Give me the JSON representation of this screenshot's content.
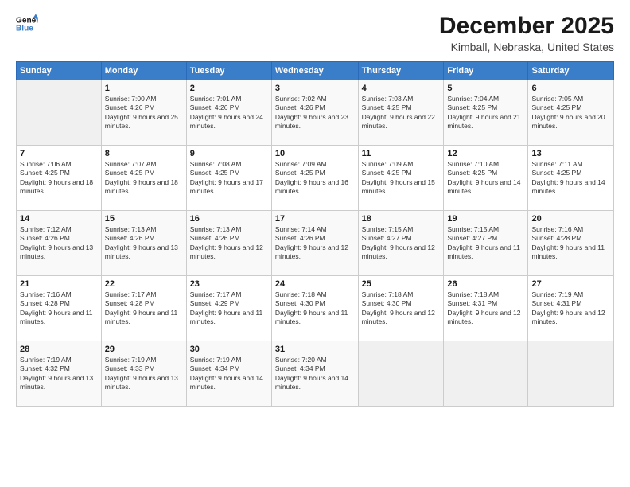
{
  "header": {
    "title": "December 2025",
    "subtitle": "Kimball, Nebraska, United States"
  },
  "columns": [
    "Sunday",
    "Monday",
    "Tuesday",
    "Wednesday",
    "Thursday",
    "Friday",
    "Saturday"
  ],
  "weeks": [
    [
      {
        "day": "",
        "sunrise": "",
        "sunset": "",
        "daylight": ""
      },
      {
        "day": "1",
        "sunrise": "Sunrise: 7:00 AM",
        "sunset": "Sunset: 4:26 PM",
        "daylight": "Daylight: 9 hours and 25 minutes."
      },
      {
        "day": "2",
        "sunrise": "Sunrise: 7:01 AM",
        "sunset": "Sunset: 4:26 PM",
        "daylight": "Daylight: 9 hours and 24 minutes."
      },
      {
        "day": "3",
        "sunrise": "Sunrise: 7:02 AM",
        "sunset": "Sunset: 4:26 PM",
        "daylight": "Daylight: 9 hours and 23 minutes."
      },
      {
        "day": "4",
        "sunrise": "Sunrise: 7:03 AM",
        "sunset": "Sunset: 4:25 PM",
        "daylight": "Daylight: 9 hours and 22 minutes."
      },
      {
        "day": "5",
        "sunrise": "Sunrise: 7:04 AM",
        "sunset": "Sunset: 4:25 PM",
        "daylight": "Daylight: 9 hours and 21 minutes."
      },
      {
        "day": "6",
        "sunrise": "Sunrise: 7:05 AM",
        "sunset": "Sunset: 4:25 PM",
        "daylight": "Daylight: 9 hours and 20 minutes."
      }
    ],
    [
      {
        "day": "7",
        "sunrise": "Sunrise: 7:06 AM",
        "sunset": "Sunset: 4:25 PM",
        "daylight": "Daylight: 9 hours and 18 minutes."
      },
      {
        "day": "8",
        "sunrise": "Sunrise: 7:07 AM",
        "sunset": "Sunset: 4:25 PM",
        "daylight": "Daylight: 9 hours and 18 minutes."
      },
      {
        "day": "9",
        "sunrise": "Sunrise: 7:08 AM",
        "sunset": "Sunset: 4:25 PM",
        "daylight": "Daylight: 9 hours and 17 minutes."
      },
      {
        "day": "10",
        "sunrise": "Sunrise: 7:09 AM",
        "sunset": "Sunset: 4:25 PM",
        "daylight": "Daylight: 9 hours and 16 minutes."
      },
      {
        "day": "11",
        "sunrise": "Sunrise: 7:09 AM",
        "sunset": "Sunset: 4:25 PM",
        "daylight": "Daylight: 9 hours and 15 minutes."
      },
      {
        "day": "12",
        "sunrise": "Sunrise: 7:10 AM",
        "sunset": "Sunset: 4:25 PM",
        "daylight": "Daylight: 9 hours and 14 minutes."
      },
      {
        "day": "13",
        "sunrise": "Sunrise: 7:11 AM",
        "sunset": "Sunset: 4:25 PM",
        "daylight": "Daylight: 9 hours and 14 minutes."
      }
    ],
    [
      {
        "day": "14",
        "sunrise": "Sunrise: 7:12 AM",
        "sunset": "Sunset: 4:26 PM",
        "daylight": "Daylight: 9 hours and 13 minutes."
      },
      {
        "day": "15",
        "sunrise": "Sunrise: 7:13 AM",
        "sunset": "Sunset: 4:26 PM",
        "daylight": "Daylight: 9 hours and 13 minutes."
      },
      {
        "day": "16",
        "sunrise": "Sunrise: 7:13 AM",
        "sunset": "Sunset: 4:26 PM",
        "daylight": "Daylight: 9 hours and 12 minutes."
      },
      {
        "day": "17",
        "sunrise": "Sunrise: 7:14 AM",
        "sunset": "Sunset: 4:26 PM",
        "daylight": "Daylight: 9 hours and 12 minutes."
      },
      {
        "day": "18",
        "sunrise": "Sunrise: 7:15 AM",
        "sunset": "Sunset: 4:27 PM",
        "daylight": "Daylight: 9 hours and 12 minutes."
      },
      {
        "day": "19",
        "sunrise": "Sunrise: 7:15 AM",
        "sunset": "Sunset: 4:27 PM",
        "daylight": "Daylight: 9 hours and 11 minutes."
      },
      {
        "day": "20",
        "sunrise": "Sunrise: 7:16 AM",
        "sunset": "Sunset: 4:28 PM",
        "daylight": "Daylight: 9 hours and 11 minutes."
      }
    ],
    [
      {
        "day": "21",
        "sunrise": "Sunrise: 7:16 AM",
        "sunset": "Sunset: 4:28 PM",
        "daylight": "Daylight: 9 hours and 11 minutes."
      },
      {
        "day": "22",
        "sunrise": "Sunrise: 7:17 AM",
        "sunset": "Sunset: 4:28 PM",
        "daylight": "Daylight: 9 hours and 11 minutes."
      },
      {
        "day": "23",
        "sunrise": "Sunrise: 7:17 AM",
        "sunset": "Sunset: 4:29 PM",
        "daylight": "Daylight: 9 hours and 11 minutes."
      },
      {
        "day": "24",
        "sunrise": "Sunrise: 7:18 AM",
        "sunset": "Sunset: 4:30 PM",
        "daylight": "Daylight: 9 hours and 11 minutes."
      },
      {
        "day": "25",
        "sunrise": "Sunrise: 7:18 AM",
        "sunset": "Sunset: 4:30 PM",
        "daylight": "Daylight: 9 hours and 12 minutes."
      },
      {
        "day": "26",
        "sunrise": "Sunrise: 7:18 AM",
        "sunset": "Sunset: 4:31 PM",
        "daylight": "Daylight: 9 hours and 12 minutes."
      },
      {
        "day": "27",
        "sunrise": "Sunrise: 7:19 AM",
        "sunset": "Sunset: 4:31 PM",
        "daylight": "Daylight: 9 hours and 12 minutes."
      }
    ],
    [
      {
        "day": "28",
        "sunrise": "Sunrise: 7:19 AM",
        "sunset": "Sunset: 4:32 PM",
        "daylight": "Daylight: 9 hours and 13 minutes."
      },
      {
        "day": "29",
        "sunrise": "Sunrise: 7:19 AM",
        "sunset": "Sunset: 4:33 PM",
        "daylight": "Daylight: 9 hours and 13 minutes."
      },
      {
        "day": "30",
        "sunrise": "Sunrise: 7:19 AM",
        "sunset": "Sunset: 4:34 PM",
        "daylight": "Daylight: 9 hours and 14 minutes."
      },
      {
        "day": "31",
        "sunrise": "Sunrise: 7:20 AM",
        "sunset": "Sunset: 4:34 PM",
        "daylight": "Daylight: 9 hours and 14 minutes."
      },
      {
        "day": "",
        "sunrise": "",
        "sunset": "",
        "daylight": ""
      },
      {
        "day": "",
        "sunrise": "",
        "sunset": "",
        "daylight": ""
      },
      {
        "day": "",
        "sunrise": "",
        "sunset": "",
        "daylight": ""
      }
    ]
  ]
}
